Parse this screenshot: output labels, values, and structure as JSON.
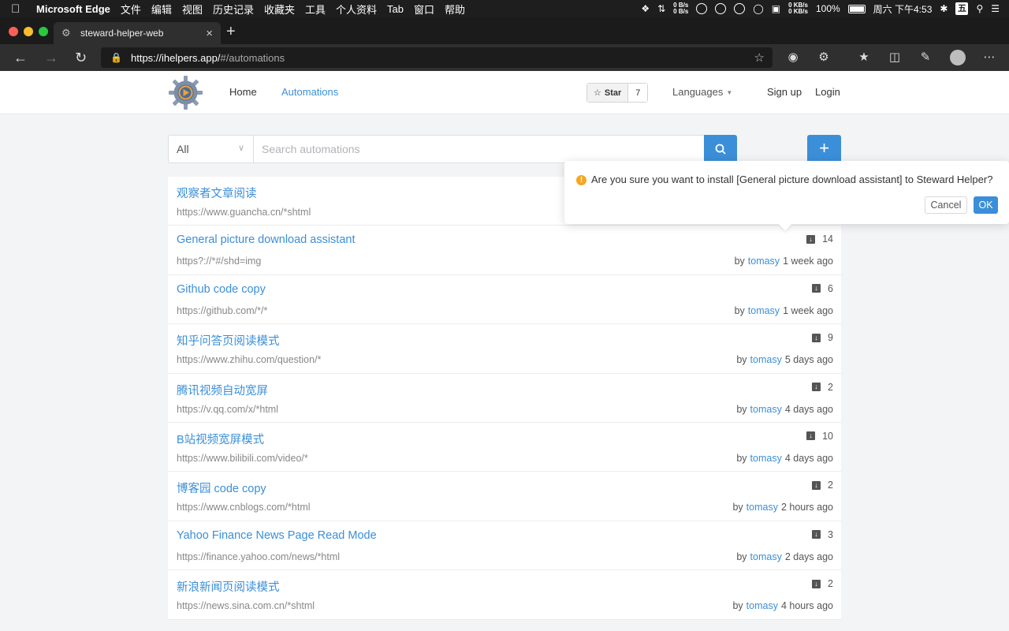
{
  "menubar": {
    "app_name": "Microsoft Edge",
    "items": [
      "文件",
      "编辑",
      "视图",
      "历史记录",
      "收藏夹",
      "工具",
      "个人资料",
      "Tab",
      "窗口",
      "帮助"
    ],
    "net_up": "0 B/s",
    "net_down": "0 B/s",
    "net2_up": "0 KB/s",
    "net2_down": "0 KB/s",
    "battery": "100%",
    "clock": "周六 下午4:53",
    "ime": "五"
  },
  "browser": {
    "tab_title": "steward-helper-web",
    "url_host": "https://ihelpers.app/",
    "url_path": "#/automations"
  },
  "header": {
    "nav": [
      "Home",
      "Automations"
    ],
    "star_label": "Star",
    "star_count": "7",
    "languages": "Languages",
    "signup": "Sign up",
    "login": "Login"
  },
  "search": {
    "filter_value": "All",
    "placeholder": "Search automations"
  },
  "popconfirm": {
    "message": "Are you sure you want to install [General picture download assistant] to Steward Helper?",
    "cancel": "Cancel",
    "ok": "OK"
  },
  "automations": [
    {
      "title": "观察者文章阅读",
      "pattern": "https://www.guancha.cn/*shtml",
      "downloads": "",
      "by": "",
      "author": "",
      "time": ""
    },
    {
      "title": "General picture download assistant",
      "pattern": "https?://*#/shd=img",
      "downloads": "14",
      "by": "by",
      "author": "tomasy",
      "time": "1 week ago"
    },
    {
      "title": "Github code copy",
      "pattern": "https://github.com/*/*",
      "downloads": "6",
      "by": "by",
      "author": "tomasy",
      "time": "1 week ago"
    },
    {
      "title": "知乎问答页阅读模式",
      "pattern": "https://www.zhihu.com/question/*",
      "downloads": "9",
      "by": "by",
      "author": "tomasy",
      "time": "5 days ago"
    },
    {
      "title": "腾讯视频自动宽屏",
      "pattern": "https://v.qq.com/x/*html",
      "downloads": "2",
      "by": "by",
      "author": "tomasy",
      "time": "4 days ago"
    },
    {
      "title": "B站视频宽屏模式",
      "pattern": "https://www.bilibili.com/video/*",
      "downloads": "10",
      "by": "by",
      "author": "tomasy",
      "time": "4 days ago"
    },
    {
      "title": "博客园 code copy",
      "pattern": "https://www.cnblogs.com/*html",
      "downloads": "2",
      "by": "by",
      "author": "tomasy",
      "time": "2 hours ago"
    },
    {
      "title": "Yahoo Finance News Page Read Mode",
      "pattern": "https://finance.yahoo.com/news/*html",
      "downloads": "3",
      "by": "by",
      "author": "tomasy",
      "time": "2 days ago"
    },
    {
      "title": "新浪新闻页阅读模式",
      "pattern": "https://news.sina.com.cn/*shtml",
      "downloads": "2",
      "by": "by",
      "author": "tomasy",
      "time": "4 hours ago"
    }
  ],
  "colors": {
    "accent": "#3b8fd8",
    "warning": "#f5a623"
  }
}
